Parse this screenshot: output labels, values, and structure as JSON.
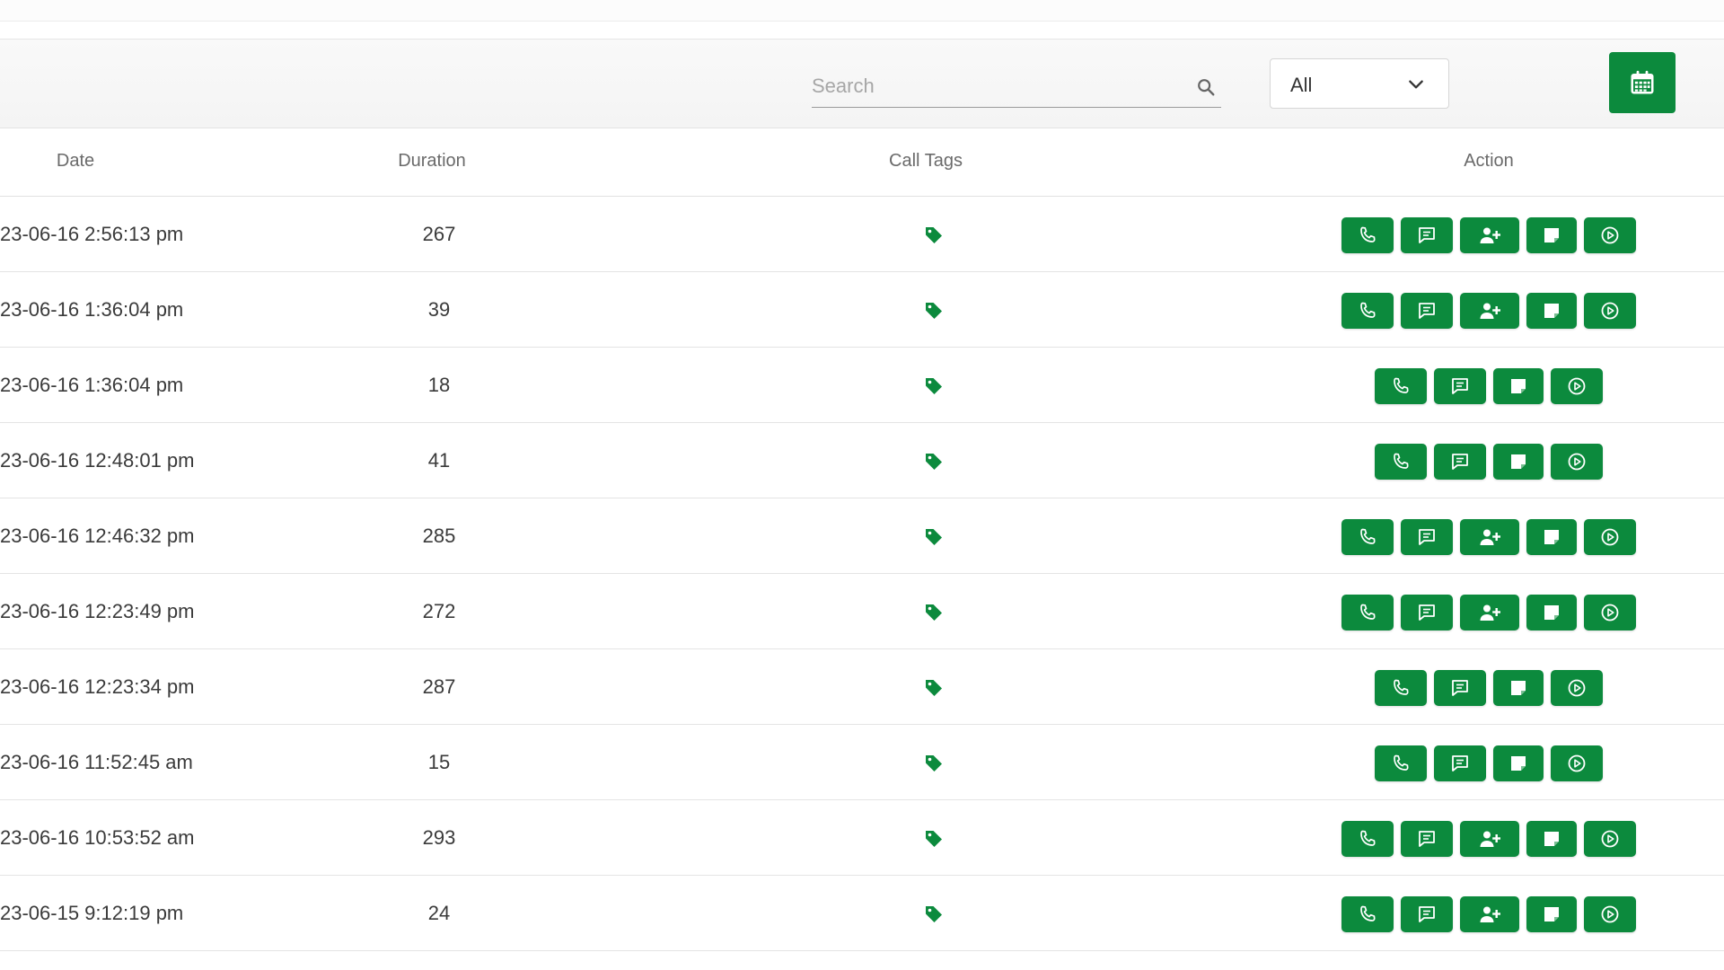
{
  "toolbar": {
    "search_placeholder": "Search",
    "filter_selected": "All"
  },
  "colors": {
    "accent": "#0c8a3d"
  },
  "icons": {
    "search": "search-icon",
    "chevron": "chevron-down-icon",
    "calendar": "calendar-icon",
    "tag": "tag-icon",
    "call": "phone-icon",
    "message": "message-icon",
    "add_contact": "user-plus-icon",
    "note": "note-icon",
    "play": "play-icon"
  },
  "table": {
    "headers": {
      "date": "Date",
      "duration": "Duration",
      "tags": "Call Tags",
      "action": "Action"
    },
    "rows": [
      {
        "date": "23-06-16 2:56:13 pm",
        "duration": "267",
        "add_contact": true
      },
      {
        "date": "23-06-16 1:36:04 pm",
        "duration": "39",
        "add_contact": true
      },
      {
        "date": "23-06-16 1:36:04 pm",
        "duration": "18",
        "add_contact": false
      },
      {
        "date": "23-06-16 12:48:01 pm",
        "duration": "41",
        "add_contact": false
      },
      {
        "date": "23-06-16 12:46:32 pm",
        "duration": "285",
        "add_contact": true
      },
      {
        "date": "23-06-16 12:23:49 pm",
        "duration": "272",
        "add_contact": true
      },
      {
        "date": "23-06-16 12:23:34 pm",
        "duration": "287",
        "add_contact": false
      },
      {
        "date": "23-06-16 11:52:45 am",
        "duration": "15",
        "add_contact": false
      },
      {
        "date": "23-06-16 10:53:52 am",
        "duration": "293",
        "add_contact": true
      },
      {
        "date": "23-06-15 9:12:19 pm",
        "duration": "24",
        "add_contact": true
      }
    ]
  }
}
